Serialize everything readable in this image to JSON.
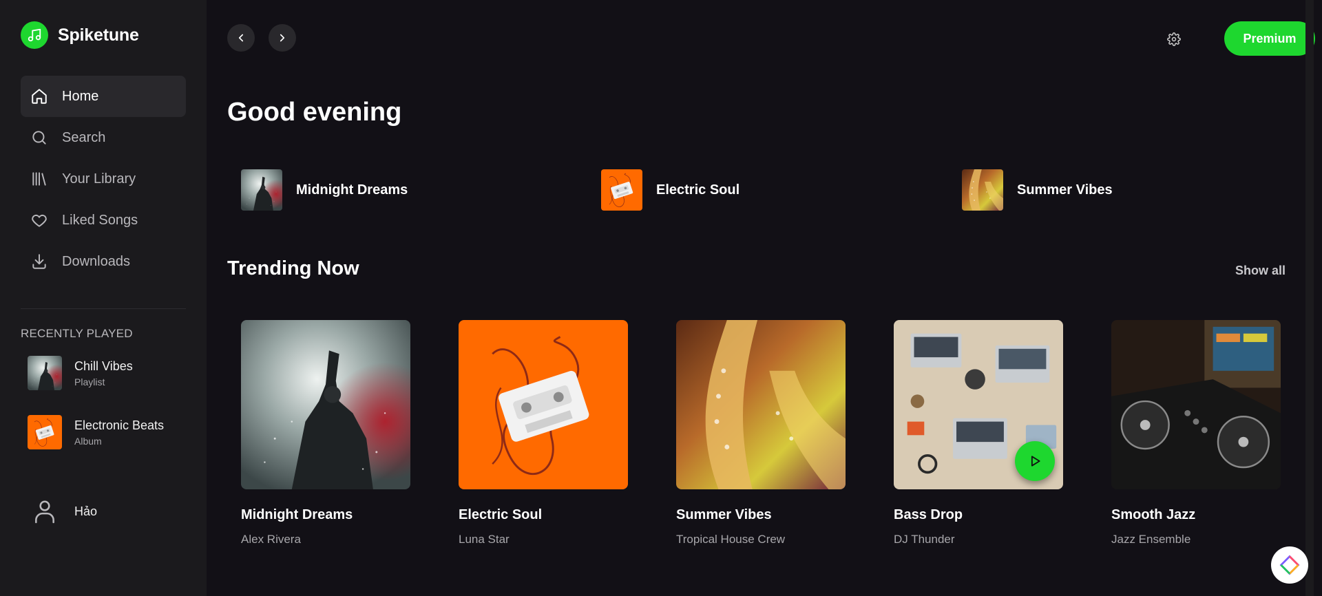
{
  "brand": {
    "name": "Spiketune",
    "accent": "#1ed72f"
  },
  "sidebar": {
    "nav": [
      {
        "label": "Home",
        "icon": "home-icon",
        "active": true
      },
      {
        "label": "Search",
        "icon": "search-icon"
      },
      {
        "label": "Your Library",
        "icon": "library-icon"
      },
      {
        "label": "Liked Songs",
        "icon": "heart-icon"
      },
      {
        "label": "Downloads",
        "icon": "download-icon"
      }
    ],
    "recent_title": "RECENTLY PLAYED",
    "recent": [
      {
        "name": "Chill Vibes",
        "type": "Playlist"
      },
      {
        "name": "Electronic Beats",
        "type": "Album"
      }
    ],
    "user": {
      "name": "Hảo"
    }
  },
  "topbar": {
    "premium_label": "Premium"
  },
  "main": {
    "greeting": "Good evening",
    "quick": [
      {
        "label": "Midnight Dreams"
      },
      {
        "label": "Electric Soul"
      },
      {
        "label": "Summer Vibes"
      }
    ],
    "trending": {
      "title": "Trending Now",
      "show_all": "Show all",
      "items": [
        {
          "title": "Midnight Dreams",
          "artist": "Alex Rivera"
        },
        {
          "title": "Electric Soul",
          "artist": "Luna Star"
        },
        {
          "title": "Summer Vibes",
          "artist": "Tropical House Crew"
        },
        {
          "title": "Bass Drop",
          "artist": "DJ Thunder"
        },
        {
          "title": "Smooth Jazz",
          "artist": "Jazz Ensemble"
        }
      ]
    }
  }
}
